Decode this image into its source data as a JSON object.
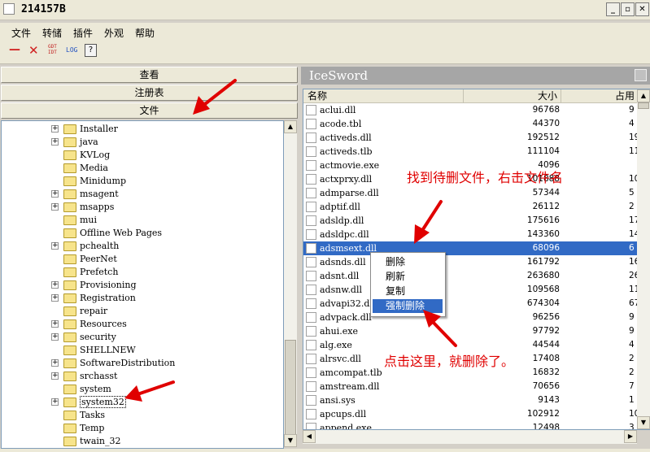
{
  "window": {
    "title": "214157B",
    "minimize": "_",
    "restore": "▫",
    "close": "✕"
  },
  "menu": [
    "文件",
    "转储",
    "插件",
    "外观",
    "帮助"
  ],
  "toolbar": {
    "t1": "—",
    "t2": "✕",
    "t3a": "GDT",
    "t3b": "IDT",
    "t4": "LOG",
    "t5": "?"
  },
  "nav": {
    "view": "查看",
    "registry": "注册表",
    "file": "文件"
  },
  "tree": [
    {
      "label": "Installer",
      "expand": true
    },
    {
      "label": "java",
      "expand": true
    },
    {
      "label": "KVLog",
      "expand": false
    },
    {
      "label": "Media",
      "expand": false
    },
    {
      "label": "Minidump",
      "expand": false
    },
    {
      "label": "msagent",
      "expand": true
    },
    {
      "label": "msapps",
      "expand": true
    },
    {
      "label": "mui",
      "expand": false
    },
    {
      "label": "Offline Web Pages",
      "expand": false
    },
    {
      "label": "pchealth",
      "expand": true
    },
    {
      "label": "PeerNet",
      "expand": false
    },
    {
      "label": "Prefetch",
      "expand": false
    },
    {
      "label": "Provisioning",
      "expand": true
    },
    {
      "label": "Registration",
      "expand": true
    },
    {
      "label": "repair",
      "expand": false
    },
    {
      "label": "Resources",
      "expand": true
    },
    {
      "label": "security",
      "expand": true
    },
    {
      "label": "SHELLNEW",
      "expand": false
    },
    {
      "label": "SoftwareDistribution",
      "expand": true
    },
    {
      "label": "srchasst",
      "expand": true
    },
    {
      "label": "system",
      "expand": false
    },
    {
      "label": "system32",
      "expand": true
    },
    {
      "label": "Tasks",
      "expand": false
    },
    {
      "label": "Temp",
      "expand": false
    },
    {
      "label": "twain_32",
      "expand": false
    }
  ],
  "right": {
    "title": "IceSword",
    "columns": {
      "name": "名称",
      "size": "大小",
      "usage": "占用"
    },
    "files": [
      {
        "name": "aclui.dll",
        "size": "96768",
        "use": "9"
      },
      {
        "name": "acode.tbl",
        "size": "44370",
        "use": "4"
      },
      {
        "name": "activeds.dll",
        "size": "192512",
        "use": "19"
      },
      {
        "name": "activeds.tlb",
        "size": "111104",
        "use": "11"
      },
      {
        "name": "actmovie.exe",
        "size": "4096",
        "use": ""
      },
      {
        "name": "actxprxy.dll",
        "size": "101888",
        "use": "10"
      },
      {
        "name": "admparse.dll",
        "size": "57344",
        "use": "5"
      },
      {
        "name": "adptif.dll",
        "size": "26112",
        "use": "2"
      },
      {
        "name": "adsldp.dll",
        "size": "175616",
        "use": "17"
      },
      {
        "name": "adsldpc.dll",
        "size": "143360",
        "use": "14"
      },
      {
        "name": "adsmsext.dll",
        "size": "68096",
        "use": "6"
      },
      {
        "name": "adsnds.dll",
        "size": "161792",
        "use": "16"
      },
      {
        "name": "adsnt.dll",
        "size": "263680",
        "use": "26"
      },
      {
        "name": "adsnw.dll",
        "size": "109568",
        "use": "11"
      },
      {
        "name": "advapi32.dll",
        "size": "674304",
        "use": "67"
      },
      {
        "name": "advpack.dll",
        "size": "96256",
        "use": "9"
      },
      {
        "name": "ahui.exe",
        "size": "97792",
        "use": "9"
      },
      {
        "name": "alg.exe",
        "size": "44544",
        "use": "4"
      },
      {
        "name": "alrsvc.dll",
        "size": "17408",
        "use": "2"
      },
      {
        "name": "amcompat.tlb",
        "size": "16832",
        "use": "2"
      },
      {
        "name": "amstream.dll",
        "size": "70656",
        "use": "7"
      },
      {
        "name": "ansi.sys",
        "size": "9143",
        "use": "1"
      },
      {
        "name": "apcups.dll",
        "size": "102912",
        "use": "10"
      },
      {
        "name": "append.exe",
        "size": "12498",
        "use": "3"
      }
    ]
  },
  "context_menu": [
    "删除",
    "刷新",
    "复制",
    "强制删除"
  ],
  "annotations": {
    "find": "找到待删文件，右击文件名",
    "click": "点击这里，就删除了。"
  },
  "accent": "#316ac5",
  "annotation_color": "#e00000"
}
